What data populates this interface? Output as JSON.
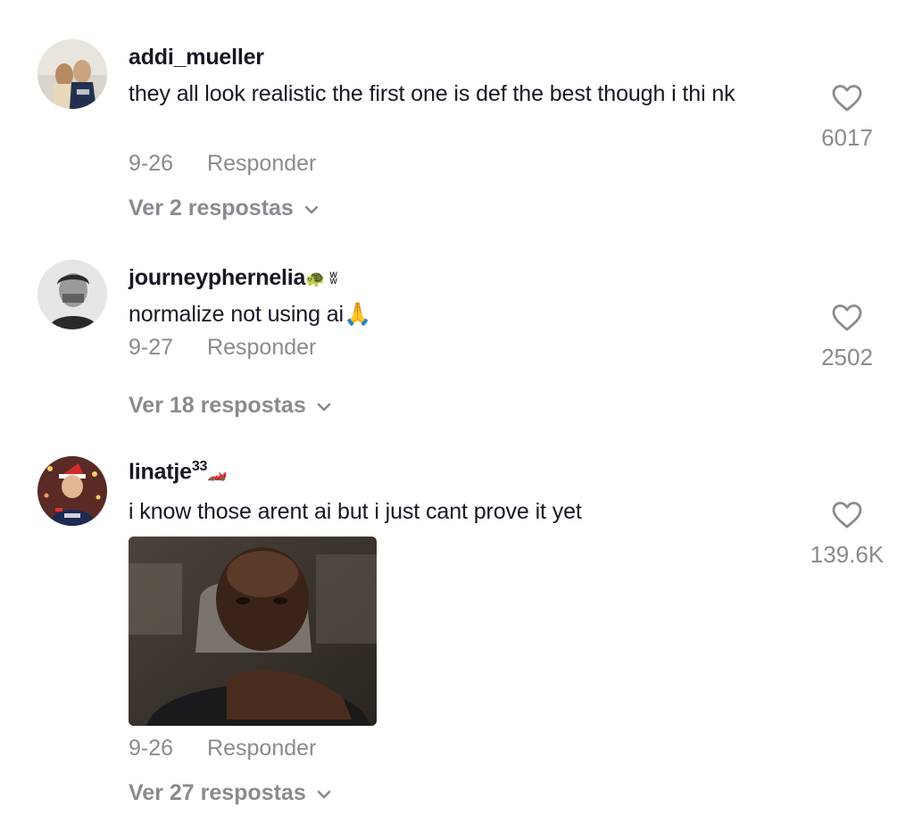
{
  "comments": [
    {
      "username": "addi_mueller",
      "username_emoji": "",
      "text": "they all look realistic the first one is def the best though i thi nk",
      "date": "9-26",
      "reply_label": "Responder",
      "replies_label": "Ver 2 respostas",
      "likes": "6017",
      "avatar_icon": "user-photo-icon"
    },
    {
      "username": "journeyphernelia",
      "username_emoji": "🐢 ʬ",
      "text": "normalize not using ai🙏",
      "date": "9-27",
      "reply_label": "Responder",
      "replies_label": "Ver 18 respostas",
      "likes": "2502",
      "avatar_icon": "user-photo-icon"
    },
    {
      "username": "linatje",
      "username_sup": "33",
      "username_emoji": "🏎️",
      "text": "i know those arent ai but i just cant prove it yet",
      "date": "9-26",
      "reply_label": "Responder",
      "replies_label": "Ver 27 respostas",
      "likes": "139.6K",
      "avatar_icon": "user-photo-icon",
      "attachment": "gif-image"
    }
  ],
  "icons": {
    "like": "heart-outline-icon",
    "expand": "chevron-down-icon"
  },
  "colors": {
    "primary_text": "#161823",
    "secondary_text": "#8a8b91"
  }
}
